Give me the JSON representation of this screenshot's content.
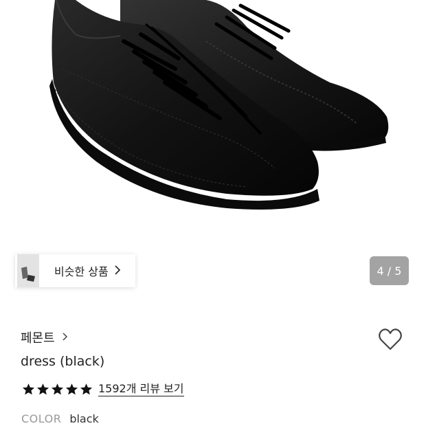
{
  "similar": {
    "label": "비슷한 상품",
    "chevron": "chevron-right-icon"
  },
  "pager": {
    "text": "4 / 5"
  },
  "product": {
    "brand": "페몬트",
    "brand_chevron": "chevron-right-icon",
    "name": "dress (black)",
    "rating_stars": 5,
    "rating_max": 5,
    "reviews_link": "1592개 리뷰 보기",
    "color_label": "COLOR",
    "color_value": "black"
  },
  "icons": {
    "wishlist": "heart-outline-icon",
    "star": "star-filled-icon"
  },
  "colors": {
    "text": "#222222",
    "muted": "#999999",
    "pager_bg": "#808080",
    "shoe": "#111111"
  }
}
